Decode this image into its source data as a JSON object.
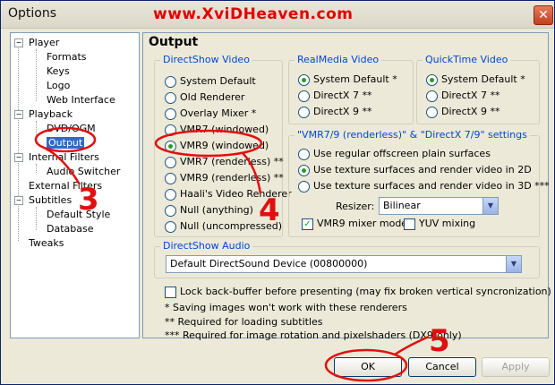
{
  "window": {
    "title": "Options",
    "brand": "www.XviDHeaven.com",
    "close_glyph": "✕"
  },
  "tree": {
    "items": [
      {
        "label": "Player",
        "toggle": "−"
      },
      {
        "label": "Formats"
      },
      {
        "label": "Keys"
      },
      {
        "label": "Logo"
      },
      {
        "label": "Web Interface"
      },
      {
        "label": "Playback",
        "toggle": "−"
      },
      {
        "label": "DVD/OGM"
      },
      {
        "label": "Output",
        "selected": true
      },
      {
        "label": "Internal Filters",
        "toggle": "−"
      },
      {
        "label": "Audio Switcher"
      },
      {
        "label": "External Filters"
      },
      {
        "label": "Subtitles",
        "toggle": "−"
      },
      {
        "label": "Default Style"
      },
      {
        "label": "Database"
      },
      {
        "label": "Tweaks"
      }
    ]
  },
  "panel": {
    "heading": "Output",
    "directshow_video": {
      "title": "DirectShow Video",
      "options": [
        "System Default",
        "Old Renderer",
        "Overlay Mixer *",
        "VMR7 (windowed)",
        "VMR9 (windowed)",
        "VMR7 (renderless) **",
        "VMR9 (renderless) **",
        "Haali's Video Renderer",
        "Null (anything)",
        "Null (uncompressed)"
      ],
      "selected": "VMR9 (windowed)"
    },
    "realmedia_video": {
      "title": "RealMedia Video",
      "options": [
        "System Default *",
        "DirectX 7 **",
        "DirectX 9 **"
      ],
      "selected": "System Default *"
    },
    "quicktime_video": {
      "title": "QuickTime Video",
      "options": [
        "System Default *",
        "DirectX 7 **",
        "DirectX 9 **"
      ],
      "selected": "System Default *"
    },
    "vmr_settings": {
      "title": "\"VMR7/9 (renderless)\" & \"DirectX 7/9\" settings",
      "options": [
        "Use regular offscreen plain surfaces",
        "Use texture surfaces and render video in 2D",
        "Use texture surfaces and render video in 3D ***"
      ],
      "selected": "Use texture surfaces and render video in 2D",
      "resizer_label": "Resizer:",
      "resizer_value": "Bilinear",
      "mixer_mode_label": "VMR9 mixer mode",
      "mixer_mode_checked": true,
      "yuv_mixing_label": "YUV mixing",
      "yuv_mixing_checked": false
    },
    "directshow_audio": {
      "title": "DirectShow Audio",
      "device": "Default DirectSound Device (00800000)"
    },
    "lock_backbuffer_label": "Lock back-buffer before presenting (may fix broken vertical syncronization)",
    "lock_backbuffer_checked": false,
    "notes": [
      "* Saving images won't work with these renderers",
      "** Required for loading subtitles",
      "*** Required for image rotation and pixelshaders (DX9-only)"
    ]
  },
  "buttons": {
    "ok": "OK",
    "cancel": "Cancel",
    "apply": "Apply"
  },
  "annotations": {
    "step3": "3",
    "step4": "4",
    "step5": "5",
    "color": "#e01010"
  },
  "icons": {
    "checkmark": "✓",
    "dropdown": "▼"
  }
}
